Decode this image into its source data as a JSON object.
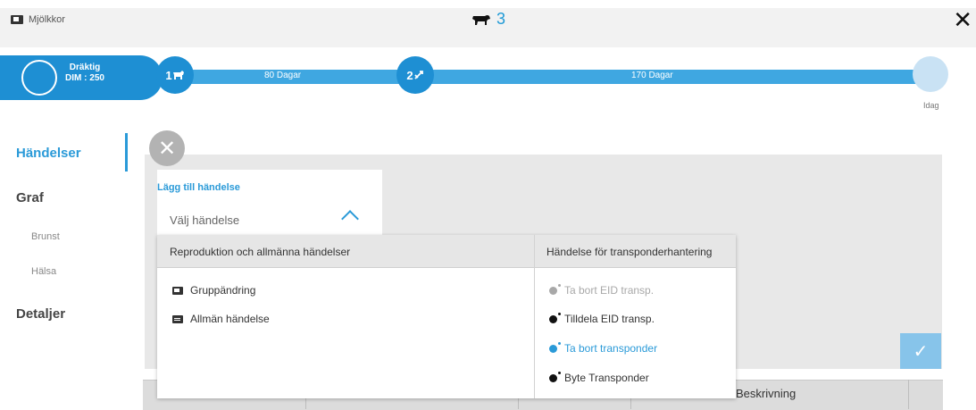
{
  "header": {
    "group_label": "Mjölkkor",
    "animal_count": "3"
  },
  "timeline": {
    "status_line1": "Dräktig",
    "status_line2": "DIM : 250",
    "node1": "1",
    "node2": "2",
    "segment1_label": "80 Dagar",
    "segment2_label": "170 Dagar",
    "end_label": "Idag"
  },
  "nav": {
    "events": "Händelser",
    "graph": "Graf",
    "heat": "Brunst",
    "health": "Hälsa",
    "details": "Detaljer"
  },
  "form": {
    "add_label": "Lägg till händelse",
    "select_placeholder": "Välj händelse"
  },
  "dropdown": {
    "col1_header": "Reproduktion och allmänna händelser",
    "col2_header": "Händelse för transponderhantering",
    "col1_items": [
      "Gruppändring",
      "Allmän händelse"
    ],
    "col2_items": [
      "Ta bort EID transp.",
      "Tilldela EID transp.",
      "Ta bort transponder",
      "Byte Transponder"
    ]
  },
  "table": {
    "col_description": "Beskrivning"
  },
  "colors": {
    "accent": "#1e8fd3",
    "disabled_text": "#a8a8a8",
    "hover_text": "#2a9ad8"
  }
}
